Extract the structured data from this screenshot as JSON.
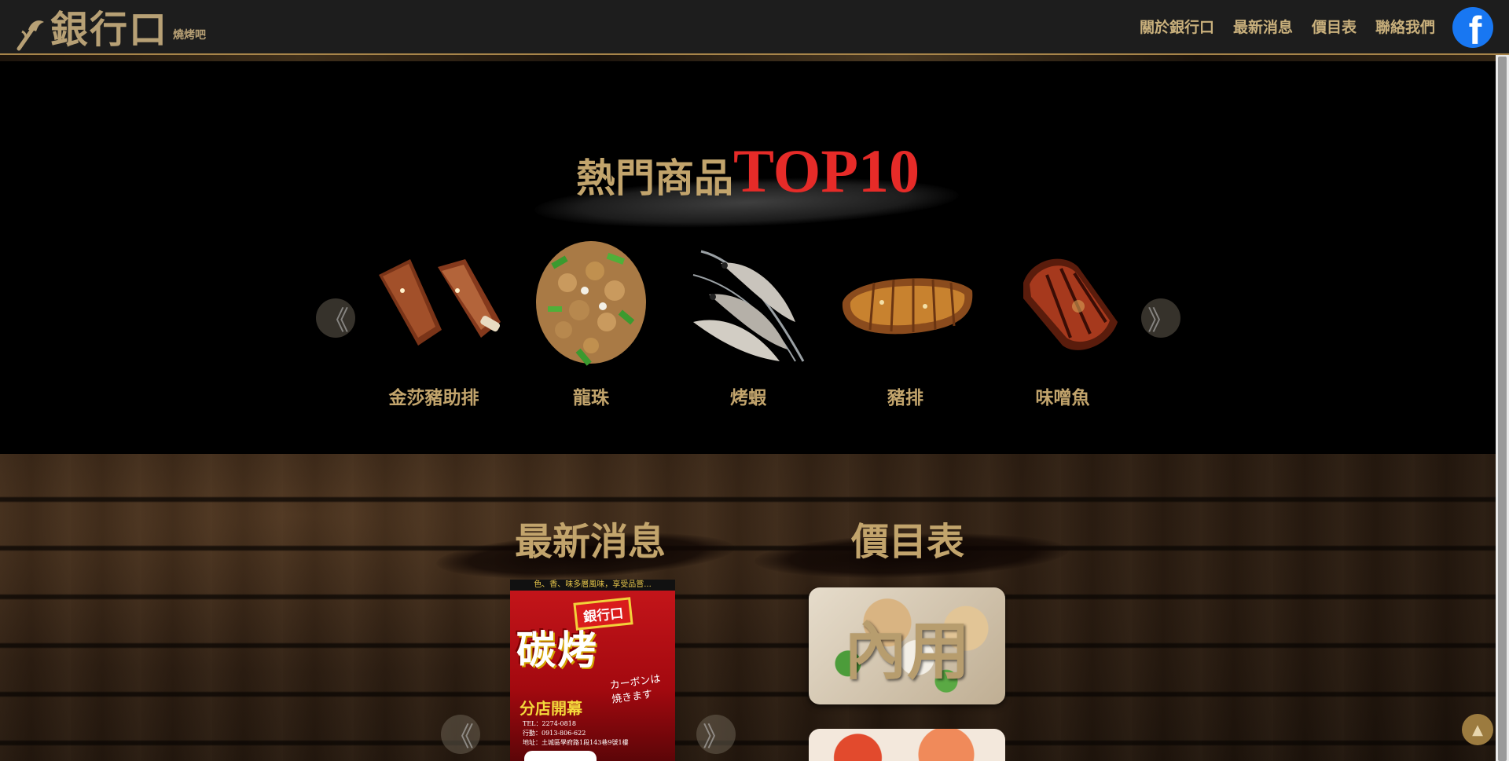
{
  "header": {
    "logo_text": "銀行口",
    "logo_sub": "燒烤吧",
    "nav": [
      "關於銀行口",
      "最新消息",
      "價目表",
      "聯絡我們"
    ],
    "facebook_glyph": "f"
  },
  "top10": {
    "title_zh": "熱門商品",
    "title_en": "TOP10",
    "prev_glyph": "《",
    "next_glyph": "》",
    "products": [
      {
        "name": "金莎豬助排",
        "icon": "pork-ribs-image"
      },
      {
        "name": "龍珠",
        "icon": "dragon-pearl-image"
      },
      {
        "name": "烤蝦",
        "icon": "grilled-shrimp-image"
      },
      {
        "name": "豬排",
        "icon": "pork-chop-image"
      },
      {
        "name": "味噌魚",
        "icon": "miso-fish-image"
      }
    ]
  },
  "news": {
    "title": "最新消息",
    "prev_glyph": "《",
    "next_glyph": "》",
    "poster": {
      "top_line": "色、香、味多層風味，享受品嘗...",
      "bank": "銀行口",
      "big": "碳烤",
      "jp": "カーボンは焼きます",
      "branch": "分店開幕",
      "info": [
        "TEL：2274-0818",
        "行動：0913-806-622",
        "地址：土城區學府路1段143巷9號1樓"
      ]
    }
  },
  "price": {
    "title": "價目表",
    "card1": "內用"
  },
  "to_top_glyph": "▲",
  "colors": {
    "gold": "#c2a46c",
    "red": "#e62b28",
    "header_bg": "#1d1d1d"
  }
}
